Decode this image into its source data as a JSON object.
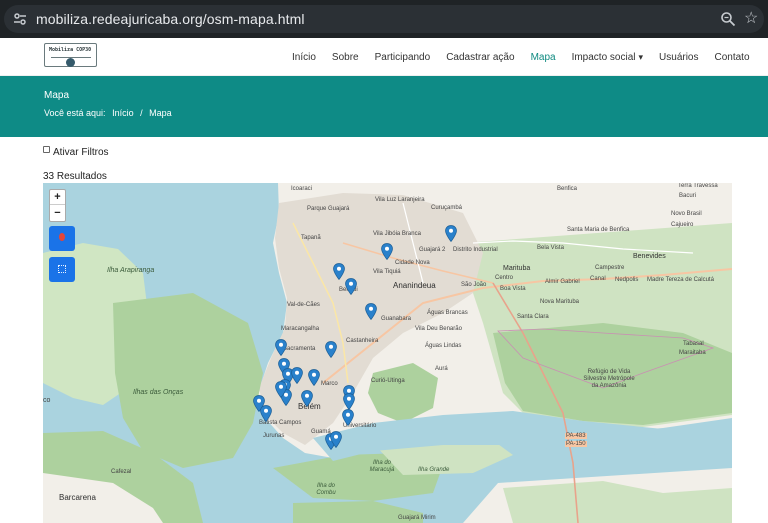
{
  "browser": {
    "url": "mobiliza.redeajuricaba.org/osm-mapa.html",
    "site_icon": "tune-icon",
    "zoom_icon": "magnifier-icon",
    "bookmark_icon": "star-icon"
  },
  "navbar": {
    "logo_text": "Mobiliza COP30",
    "links": [
      {
        "label": "Início"
      },
      {
        "label": "Sobre"
      },
      {
        "label": "Participando"
      },
      {
        "label": "Cadastrar ação"
      },
      {
        "label": "Mapa",
        "active": true
      },
      {
        "label": "Impacto social",
        "dropdown": true
      },
      {
        "label": "Usuários"
      },
      {
        "label": "Contato"
      }
    ]
  },
  "hero": {
    "title": "Mapa",
    "breadcrumb_prefix": "Você está aqui:",
    "breadcrumb_home": "Início",
    "breadcrumb_separator": "/",
    "breadcrumb_current": "Mapa"
  },
  "filters": {
    "label": "Ativar Filtros",
    "checked": false
  },
  "results": {
    "text": "33 Resultados"
  },
  "map": {
    "zoom_in": "+",
    "zoom_out": "−",
    "locate_icon": "map-marker-icon",
    "fullscreen_icon": "fullscreen-icon",
    "colors": {
      "water": "#aad3df",
      "land": "#f2efe9",
      "forest": "#add19e",
      "urban": "#e2dcd3",
      "pin": "#2a81cb",
      "accent": "#0e8b86"
    },
    "labels": [
      {
        "text": "Icoaraci"
      },
      {
        "text": "Parque Guajará"
      },
      {
        "text": "Vila Luz Laranjeira"
      },
      {
        "text": "Curuçambá"
      },
      {
        "text": "Benfica"
      },
      {
        "text": "Terra Travessa"
      },
      {
        "text": "Bacuri"
      },
      {
        "text": "Vila Jibóia Branca"
      },
      {
        "text": "Tapanã"
      },
      {
        "text": "Guajará 2"
      },
      {
        "text": "Distrito Industrial"
      },
      {
        "text": "Santa Maria de Benfica"
      },
      {
        "text": "Novo Brasil"
      },
      {
        "text": "Cajueiro"
      },
      {
        "text": "Bela Vista"
      },
      {
        "text": "Benevides"
      },
      {
        "text": "Vila Tiquiá"
      },
      {
        "text": "Cidade Nova"
      },
      {
        "text": "Marituba"
      },
      {
        "text": "Campestre"
      },
      {
        "text": "Ilha Arapiranga"
      },
      {
        "text": "Ananindeua"
      },
      {
        "text": "Centro"
      },
      {
        "text": "São João"
      },
      {
        "text": "Boa Vista"
      },
      {
        "text": "Almir Gabriel"
      },
      {
        "text": "Canal"
      },
      {
        "text": "Nedpolis"
      },
      {
        "text": "Madre Tereza de Calcutá"
      },
      {
        "text": "Val-de-Cães"
      },
      {
        "text": "Bengui"
      },
      {
        "text": "Guanabara"
      },
      {
        "text": "Águas Brancas"
      },
      {
        "text": "Nova Marituba"
      },
      {
        "text": "Santa Clara"
      },
      {
        "text": "Maracangalha"
      },
      {
        "text": "Vila Deu Benarão"
      },
      {
        "text": "Sacramenta"
      },
      {
        "text": "Castanheira"
      },
      {
        "text": "Águas Lindas"
      },
      {
        "text": "Tabasal"
      },
      {
        "text": "Maraitaba"
      },
      {
        "text": "Aurá"
      },
      {
        "text": "Ilhas das Onças"
      },
      {
        "text": "Marco"
      },
      {
        "text": "Curió-Utinga"
      },
      {
        "text": "Refúgio de Vida Silvestre Metrópole da Amazônia"
      },
      {
        "text": "Belém"
      },
      {
        "text": "Batista Campos"
      },
      {
        "text": "Jurunas"
      },
      {
        "text": "Guamá"
      },
      {
        "text": "Universitário"
      },
      {
        "text": "PA-483"
      },
      {
        "text": "PA-150"
      },
      {
        "text": "Ilha do Maracujá"
      },
      {
        "text": "Ilha Grande"
      },
      {
        "text": "Ilha do Combu"
      },
      {
        "text": "Cafezal"
      },
      {
        "text": "Barcarena"
      },
      {
        "text": "Guajará Mirim"
      },
      {
        "text": "co"
      }
    ],
    "marker_count": 22
  }
}
